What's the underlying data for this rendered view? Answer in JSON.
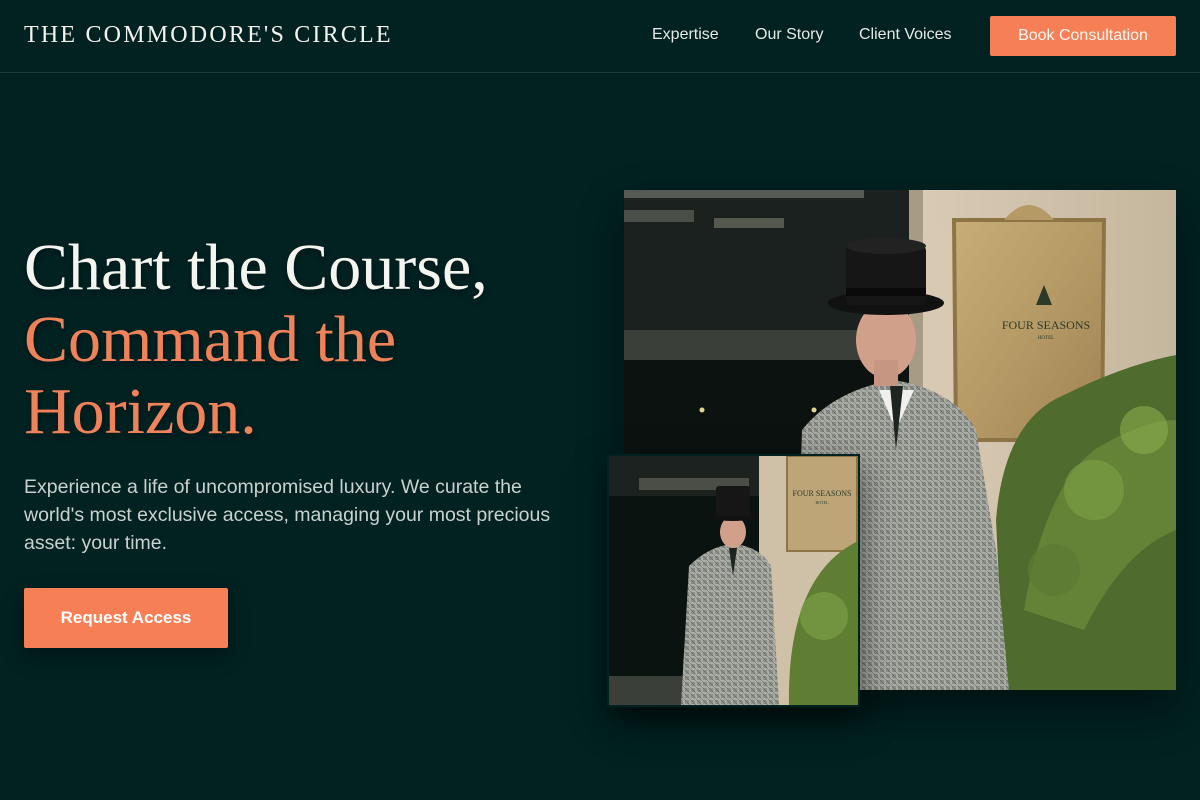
{
  "nav": {
    "brand": "THE COMMODORE'S CIRCLE",
    "links": [
      "Expertise",
      "Our Story",
      "Client Voices"
    ],
    "cta": "Book Consultation"
  },
  "hero": {
    "headline_line1": "Chart the Course,",
    "headline_line2": "Command the",
    "headline_line3": "Horizon.",
    "subtext": "Experience a life of uncompromised luxury. We curate the world's most exclusive access, managing your most precious asset: your time.",
    "cta": "Request Access"
  },
  "photos": {
    "sign_main_line1": "FOUR SEASONS",
    "sign_main_line2": "HOTEL",
    "sign_small_line1": "FOUR SEASONS",
    "sign_small_line2": "HOTEL"
  },
  "colors": {
    "background": "#022121",
    "accent": "#f77f56",
    "headline_accent": "#f0825a",
    "text": "#f5f5f0"
  }
}
